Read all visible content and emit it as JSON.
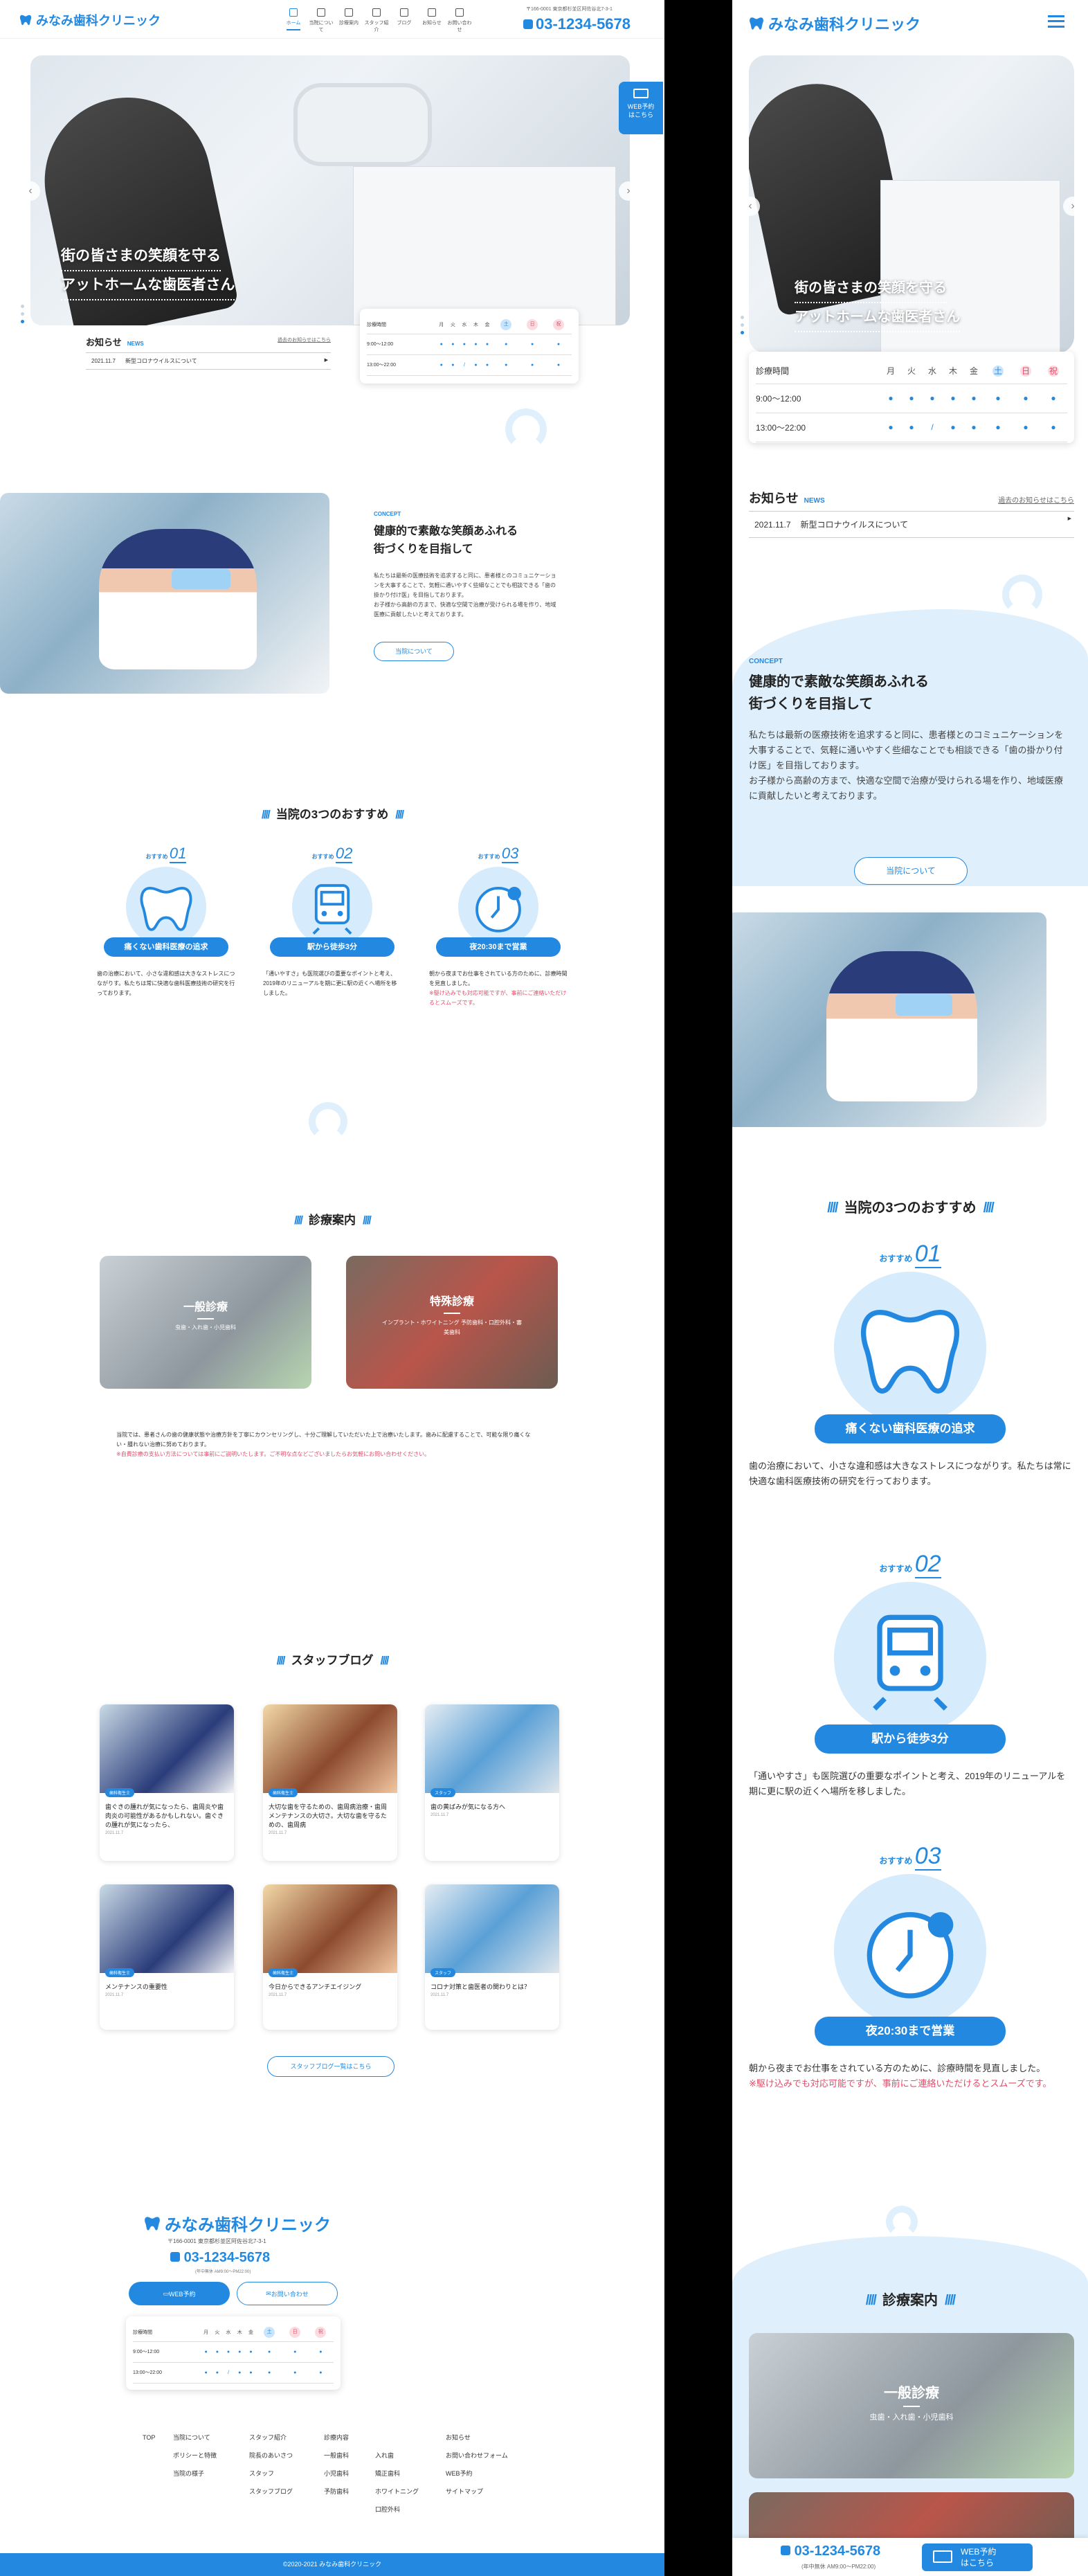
{
  "clinic": {
    "name": "みなみ歯科クリニック",
    "address": "〒166-0001 東京都杉並区阿佐谷北7-3-1",
    "tel": "03-1234-5678",
    "tel_note": "(年中無休 AM9:00〜PM22:00)"
  },
  "nav": [
    {
      "label": "ホーム",
      "icon": "home-icon",
      "active": true
    },
    {
      "label": "当院について",
      "icon": "building-icon"
    },
    {
      "label": "診療案内",
      "icon": "clipboard-icon"
    },
    {
      "label": "スタッフ紹介",
      "icon": "staff-icon"
    },
    {
      "label": "ブログ",
      "icon": "pen-icon"
    },
    {
      "label": "お知らせ",
      "icon": "bell-icon"
    },
    {
      "label": "お問い合わせ",
      "icon": "mail-icon"
    }
  ],
  "hero": {
    "line1": "街の皆さまの笑顔を守る",
    "line2": "アットホームな歯医者さん",
    "prev": "‹",
    "next": "›"
  },
  "web_reserve": {
    "line1": "WEB予約",
    "line2": "はこちら"
  },
  "news": {
    "title": "お知らせ",
    "title_en": "NEWS",
    "more": "過去のお知らせはこちら",
    "date": "2021.11.7",
    "text": "新型コロナウイルスについて"
  },
  "hours": {
    "header": [
      "診療時間",
      "月",
      "火",
      "水",
      "木",
      "金",
      "土",
      "日",
      "祝"
    ],
    "rows": [
      {
        "time": "9:00〜12:00",
        "marks": [
          "●",
          "●",
          "●",
          "●",
          "●",
          "●",
          "●",
          "●"
        ]
      },
      {
        "time": "13:00〜22:00",
        "marks": [
          "●",
          "●",
          "/",
          "●",
          "●",
          "●",
          "●",
          "●"
        ]
      }
    ]
  },
  "concept": {
    "label": "CONCEPT",
    "heading1": "健康的で素敵な笑顔あふれる",
    "heading2": "街づくりを目指して",
    "body1": "私たちは最新の医療技術を追求すると同に、患者様とのコミュニケーションを大事することで、気軽に通いやすく些細なことでも相談できる「歯の掛かり付け医」を目指しております。",
    "body2": "お子様から高齢の方まで、快適な空間で治療が受けられる場を作り、地域医療に貢献したいと考えております。",
    "button": "当院について"
  },
  "recommend": {
    "title": "当院の3つのおすすめ",
    "prefix": "おすすめ",
    "items": [
      {
        "no": "01",
        "icon": "tooth-icon",
        "tag": "痛くない歯科医療の追求",
        "text": "歯の治療において、小さな違和感は大きなストレスにつながりす。私たちは常に快適な歯科医療技術の研究を行っております。",
        "note": ""
      },
      {
        "no": "02",
        "icon": "train-icon",
        "tag": "駅から徒歩3分",
        "text": "「通いやすさ」も医院選びの重要なポイントと考え、2019年のリニューアルを期に更に駅の近くへ場所を移しました。",
        "note": ""
      },
      {
        "no": "03",
        "icon": "clock-icon",
        "tag": "夜20:30まで営業",
        "text": "朝から夜までお仕事をされている方のために、診療時間を見直しました。",
        "note": "※駆け込みでも対応可能ですが、事前にご連絡いただけるとスムーズです。"
      }
    ]
  },
  "services": {
    "title": "診療案内",
    "items": [
      {
        "name": "一般診療",
        "sub": "虫歯・入れ歯・小児歯科"
      },
      {
        "name": "特殊診療",
        "sub": "インプラント・ホワイトニング 予防歯科・口腔外科・審美歯科"
      }
    ],
    "note": "当院では、患者さんの歯の健康状態や治療方針を丁寧にカウンセリングし、十分ご理解していただいた上で治療いたします。歯みに配慮することで、可能な限り痛くない・腫れない治療に努めております。",
    "note_red": "※自費診療の支払い方法については事前にご説明いたします。ご不明な点などございましたらお気軽にお問い合わせください。"
  },
  "blog": {
    "title": "スタッフブログ",
    "button": "スタッフブログ一覧はこちら",
    "posts": [
      {
        "cat": "歯科衛生士",
        "title": "歯ぐきの腫れが気になったら、歯周炎や歯肉炎の可能性があるかもしれない。歯ぐきの腫れが気になったら、",
        "date": "2021.11.7"
      },
      {
        "cat": "歯科衛生士",
        "title": "大切な歯を守るための、歯周病治療・歯周メンテナンスの大切さ。大切な歯を守るための、歯周病",
        "date": "2021.11.7"
      },
      {
        "cat": "スタッフ",
        "title": "歯の黄ばみが気になる方へ",
        "date": "2021.11.7"
      },
      {
        "cat": "歯科衛生士",
        "title": "メンテナンスの重要性",
        "date": "2021.11.7"
      },
      {
        "cat": "歯科衛生士",
        "title": "今日からできるアンチエイジング",
        "date": "2021.11.7"
      },
      {
        "cat": "スタッフ",
        "title": "コロナ対策と歯医者の関わりとは？",
        "date": "2021.11.7"
      }
    ]
  },
  "footer": {
    "web_btn": "WEB予約",
    "contact_btn": "お問い合わせ",
    "top": "TOP",
    "cols": [
      {
        "head": "当院について",
        "items": [
          "ポリシーと特徴",
          "当院の様子"
        ]
      },
      {
        "head": "スタッフ紹介",
        "items": [
          "院長のあいさつ",
          "スタッフ",
          "スタッフブログ"
        ]
      },
      {
        "head": "診療内容",
        "items": [
          "一般歯科",
          "小児歯科",
          "予防歯科"
        ]
      },
      {
        "head": "",
        "items": [
          "入れ歯",
          "矯正歯科",
          "ホワイトニング",
          "口腔外科"
        ]
      },
      {
        "head": "お知らせ",
        "items": [
          "お問い合わせフォーム",
          "WEB予約",
          "サイトマップ"
        ]
      }
    ],
    "copyright": "©2020-2021 みなみ歯科クリニック"
  },
  "mobile_bar": {
    "tel": "03-1234-5678",
    "note": "(年中無休 AM9:00〜PM22:00)",
    "web": "WEB予約",
    "web2": "はこちら"
  },
  "colors": {
    "brand": "#2389e0",
    "light": "#dff0fc",
    "red": "#e04d6a"
  }
}
